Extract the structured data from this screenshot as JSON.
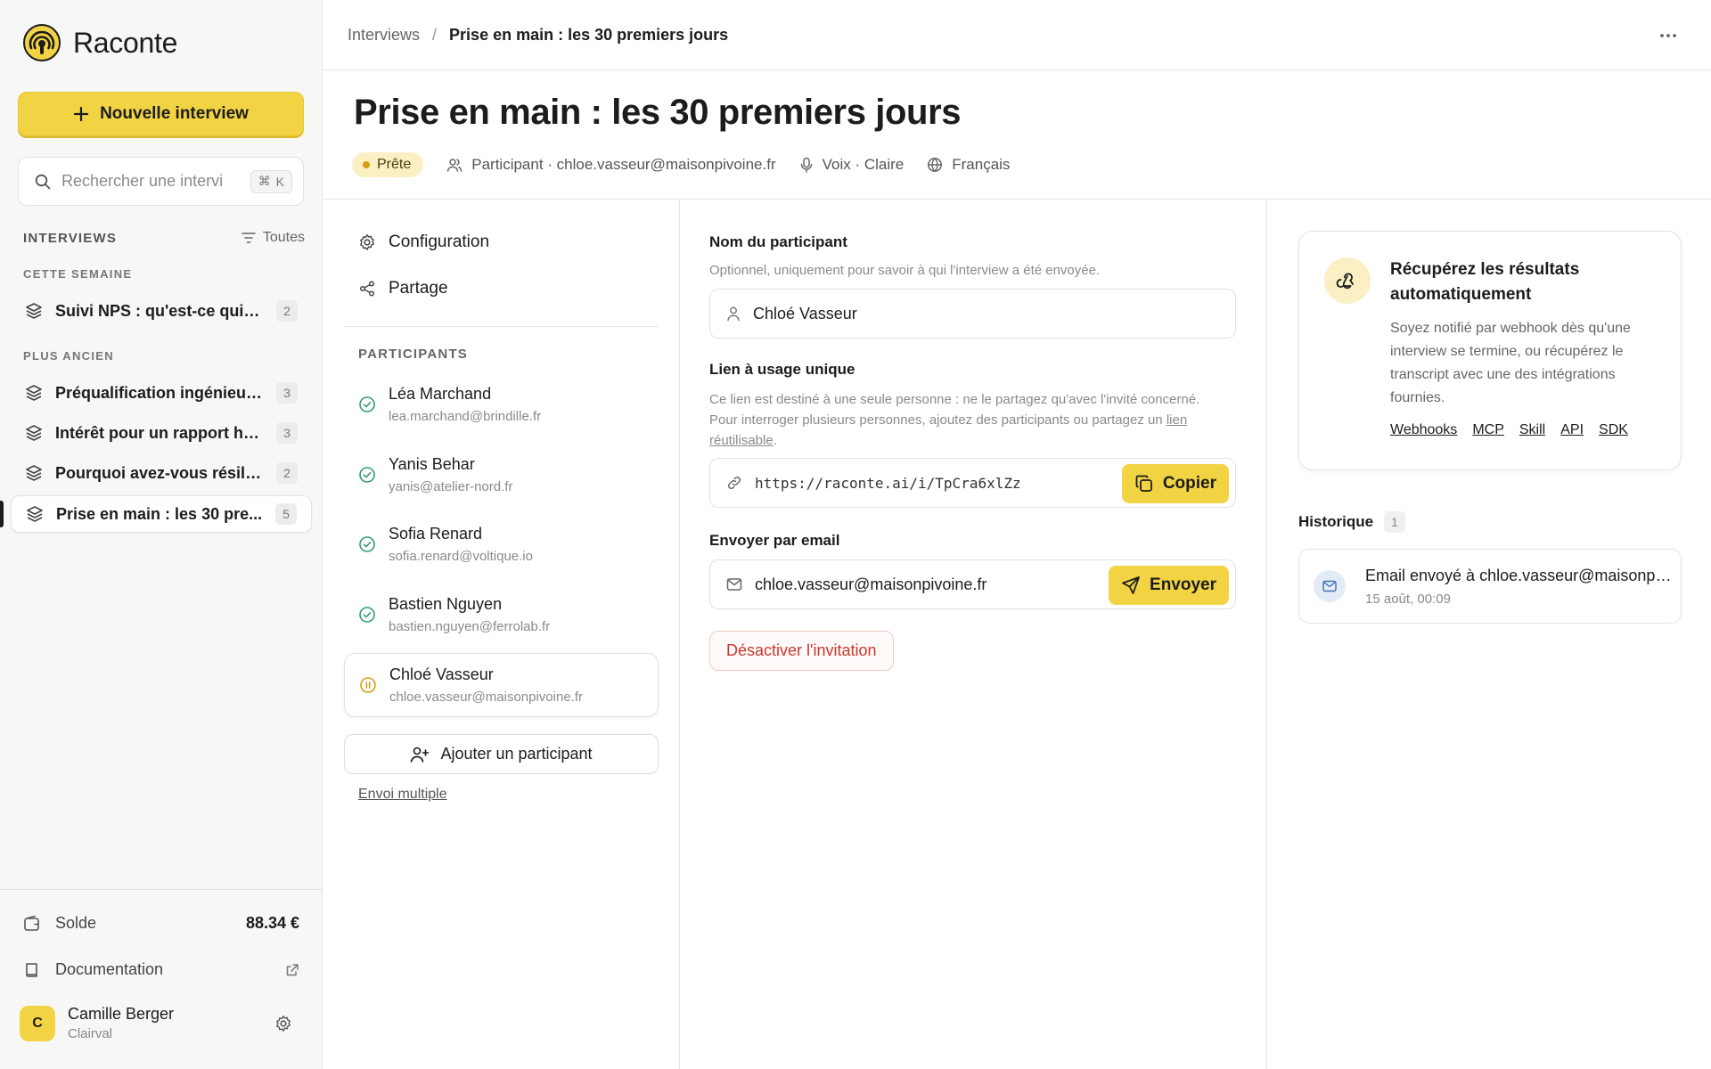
{
  "app": {
    "name": "Raconte",
    "brand_color": "#f2d344"
  },
  "sidebar": {
    "new_button": "Nouvelle interview",
    "search": {
      "placeholder": "Rechercher une intervi",
      "shortcut_symbol": "⌘",
      "shortcut_key": "K"
    },
    "section_title": "INTERVIEWS",
    "filter_label": "Toutes",
    "groups": [
      {
        "label": "CETTE SEMAINE",
        "items": [
          {
            "label": "Suivi NPS : qu'est-ce qui f...",
            "count": "2"
          }
        ]
      },
      {
        "label": "PLUS ANCIEN",
        "items": [
          {
            "label": "Préqualification ingénieur ...",
            "count": "3"
          },
          {
            "label": "Intérêt pour un rapport he...",
            "count": "3"
          },
          {
            "label": "Pourquoi avez-vous résilié ?",
            "count": "2"
          },
          {
            "label": "Prise en main : les 30 pre...",
            "count": "5",
            "active": true
          }
        ]
      }
    ],
    "balance": {
      "label": "Solde",
      "value": "88.34 €"
    },
    "docs_label": "Documentation",
    "user": {
      "initial": "C",
      "name": "Camille Berger",
      "org": "Clairval"
    }
  },
  "breadcrumb": {
    "parent": "Interviews",
    "separator": "/",
    "current": "Prise en main : les 30 premiers jours"
  },
  "page": {
    "title": "Prise en main : les 30 premiers jours",
    "status": "Prête",
    "participant_meta": "Participant · chloe.vasseur@maisonpivoine.fr",
    "voice_meta": "Voix · Claire",
    "language_meta": "Français"
  },
  "left_menu": {
    "configuration": "Configuration",
    "sharing": "Partage"
  },
  "participants": {
    "title": "PARTICIPANTS",
    "list": [
      {
        "name": "Léa Marchand",
        "email": "lea.marchand@brindille.fr",
        "status": "done"
      },
      {
        "name": "Yanis Behar",
        "email": "yanis@atelier-nord.fr",
        "status": "done"
      },
      {
        "name": "Sofia Renard",
        "email": "sofia.renard@voltique.io",
        "status": "done"
      },
      {
        "name": "Bastien Nguyen",
        "email": "bastien.nguyen@ferrolab.fr",
        "status": "done"
      },
      {
        "name": "Chloé Vasseur",
        "email": "chloe.vasseur@maisonpivoine.fr",
        "status": "pending",
        "selected": true
      }
    ],
    "add_button": "Ajouter un participant",
    "bulk_link": "Envoi multiple"
  },
  "form": {
    "name_label": "Nom du participant",
    "name_help": "Optionnel, uniquement pour savoir à qui l'interview a été envoyée.",
    "name_value": "Chloé Vasseur",
    "link_label": "Lien à usage unique",
    "link_help_1": "Ce lien est destiné à une seule personne : ne le partagez qu'avec l'invité concerné.",
    "link_help_2": "Pour interroger plusieurs personnes, ajoutez des participants ou partagez un",
    "link_help_link": "lien réutilisable",
    "link_help_end": ".",
    "link_value": "https://raconte.ai/i/TpCra6xlZz",
    "copy_button": "Copier",
    "email_label": "Envoyer par email",
    "email_value": "chloe.vasseur@maisonpivoine.fr",
    "send_button": "Envoyer",
    "deactivate_button": "Désactiver l'invitation"
  },
  "integrations_card": {
    "title": "Récupérez les résultats automatiquement",
    "body": "Soyez notifié par webhook dès qu'une interview se termine, ou récupérez le transcript avec une des intégrations fournies.",
    "links": [
      "Webhooks",
      "MCP",
      "Skill",
      "API",
      "SDK"
    ]
  },
  "history": {
    "title": "Historique",
    "count": "1",
    "items": [
      {
        "title": "Email envoyé à chloe.vasseur@maisonpivoine.fr",
        "date": "15 août, 00:09"
      }
    ]
  },
  "colors": {
    "accent": "#f2d344",
    "success": "#2f9e6f",
    "pending": "#d89b14",
    "danger": "#c9362b"
  }
}
